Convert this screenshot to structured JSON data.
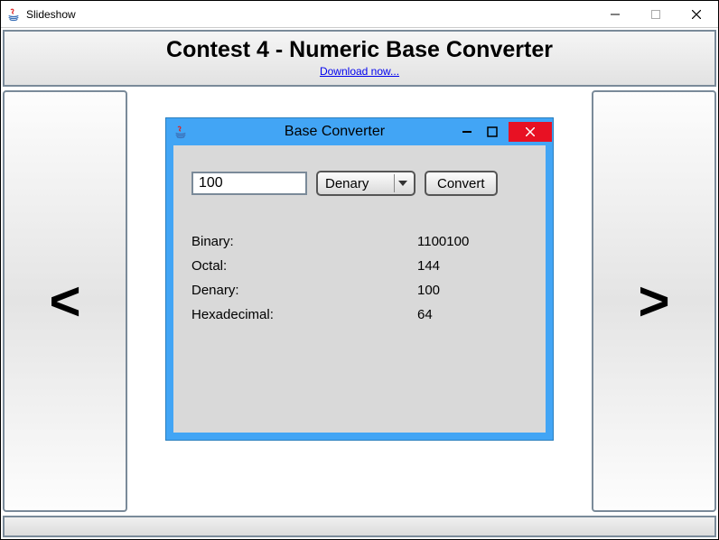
{
  "window": {
    "title": "Slideshow"
  },
  "header": {
    "title": "Contest 4 - Numeric Base Converter",
    "download_link": "Download now..."
  },
  "nav": {
    "prev": "<",
    "next": ">"
  },
  "bc": {
    "title": "Base Converter",
    "input_value": "100",
    "select_value": "Denary",
    "convert_label": "Convert",
    "results": [
      {
        "label": "Binary:",
        "value": "1100100"
      },
      {
        "label": "Octal:",
        "value": "144"
      },
      {
        "label": "Denary:",
        "value": "100"
      },
      {
        "label": "Hexadecimal:",
        "value": "64"
      }
    ]
  }
}
